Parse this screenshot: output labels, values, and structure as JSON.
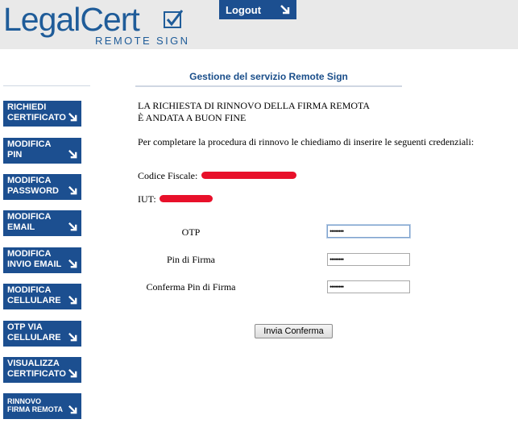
{
  "header": {
    "logo_main": "LegalCert",
    "logo_sub": "REMOTE SIGN",
    "logout_label": "Logout"
  },
  "page": {
    "title": "Gestione del servizio Remote Sign"
  },
  "sidebar": {
    "items": [
      {
        "line1": "RICHIEDI",
        "line2": "CERTIFICATO"
      },
      {
        "line1": "MODIFICA",
        "line2": "PIN"
      },
      {
        "line1": "MODIFICA",
        "line2": "PASSWORD"
      },
      {
        "line1": "MODIFICA",
        "line2": "EMAIL"
      },
      {
        "line1": "MODIFICA",
        "line2": "INVIO EMAIL"
      },
      {
        "line1": "MODIFICA",
        "line2": "CELLULARE"
      },
      {
        "line1": "OTP VIA",
        "line2": "CELLULARE"
      },
      {
        "line1": "VISUALIZZA",
        "line2": "CERTIFICATO"
      },
      {
        "line1": "RINNOVO",
        "line2": "FIRMA REMOTA"
      }
    ]
  },
  "content": {
    "message_line1": "LA RICHIESTA DI RINNOVO DELLA FIRMA REMOTA",
    "message_line2": "È ANDATA A BUON FINE",
    "paragraph": "Per completare la procedura di rinnovo le chiediamo di inserire le seguenti credenziali:",
    "codice_fiscale_label": "Codice Fiscale:",
    "iut_label": "IUT:"
  },
  "form": {
    "otp_label": "OTP",
    "otp_value": "••••••••",
    "pin_label": "Pin di Firma",
    "pin_value": "••••••••",
    "confirm_pin_label": "Conferma Pin di Firma",
    "confirm_pin_value": "••••••••",
    "submit_label": "Invia Conferma"
  },
  "colors": {
    "brand_blue": "#1c4f90",
    "header_bg": "#e9e9e9",
    "redaction": "#e8102a"
  }
}
